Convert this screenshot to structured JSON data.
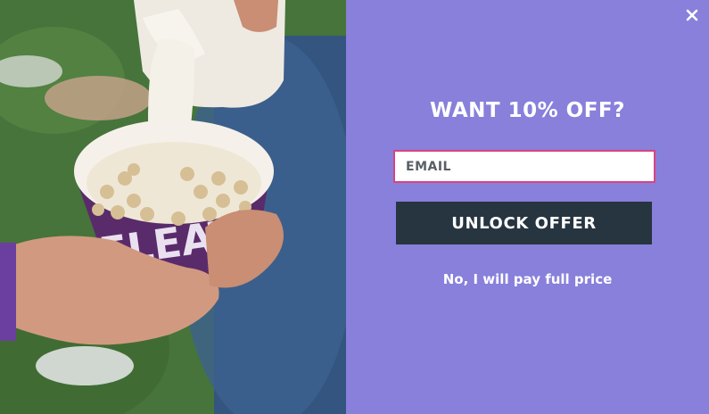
{
  "popup": {
    "headline": "WANT 10% OFF?",
    "email": {
      "value": "",
      "placeholder": "EMAIL"
    },
    "unlock_button_label": "UNLOCK OFFER",
    "decline_link_label": "No, I will pay full price",
    "close_icon": "close-icon",
    "cup_text": "ELEAT"
  },
  "colors": {
    "panel_background": "#8880db",
    "button_background": "#263540",
    "input_border": "#d9447f",
    "text": "#ffffff"
  }
}
